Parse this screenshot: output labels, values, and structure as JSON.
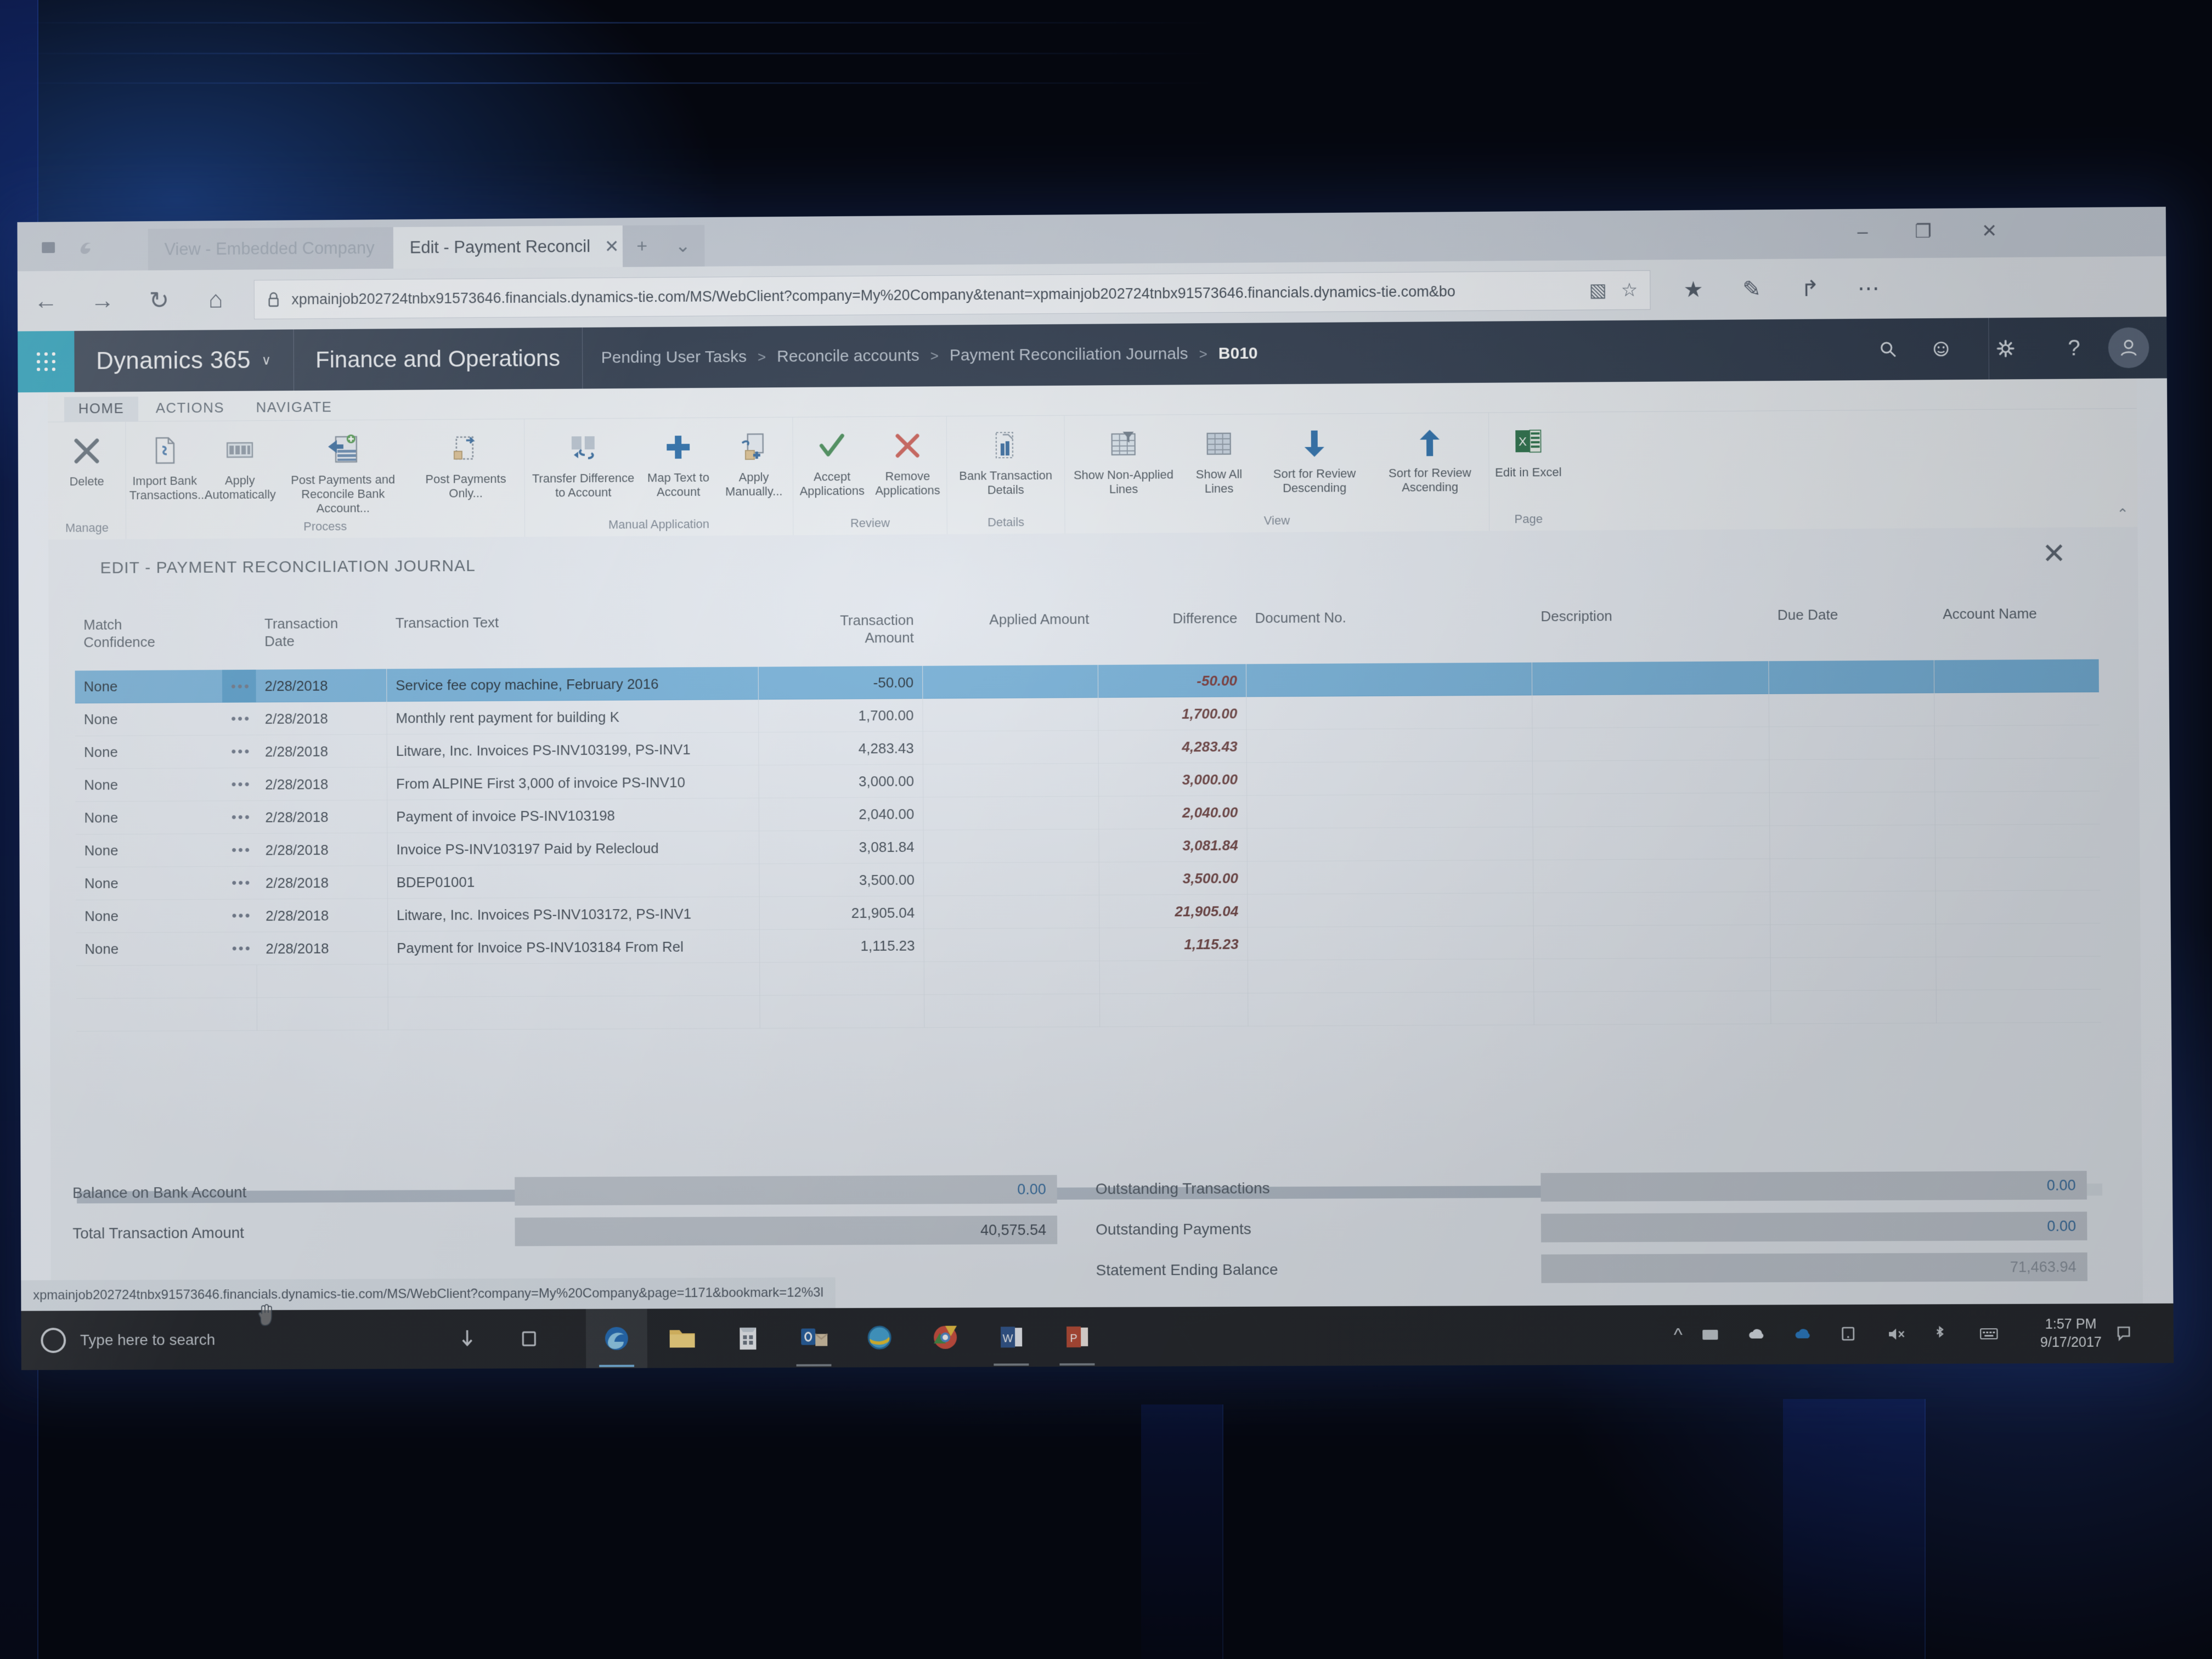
{
  "browser": {
    "tabs": [
      {
        "title": "View - Embedded Company",
        "active": false
      },
      {
        "title": "Edit - Payment Reconcil",
        "active": true
      }
    ],
    "new_tab_label": "+",
    "tab_menu_caret": "⌄",
    "tab_close": "✕",
    "window_controls": {
      "minimize": "–",
      "maximize": "❐",
      "close": "✕"
    },
    "nav": {
      "back": "←",
      "forward": "→",
      "refresh": "↻",
      "home": "⌂"
    },
    "url": "xpmainjob202724tnbx91573646.financials.dynamics-tie.com/MS/WebClient?company=My%20Company&tenant=xpmainjob202724tnbx91573646.financials.dynamics-tie.com&bo",
    "url_lock_icon": "🔒",
    "reading_view_icon": "▧",
    "favorite_icon": "☆",
    "hub_icon": "★",
    "webnote_icon": "✎",
    "share_icon": "↱",
    "more_icon": "⋯",
    "status_url": "xpmainjob202724tnbx91573646.financials.dynamics-tie.com/MS/WebClient?company=My%20Company&page=1171&bookmark=12%3l"
  },
  "d365": {
    "brand": "Dynamics 365",
    "brand_caret": "∨",
    "module": "Finance and Operations",
    "breadcrumb": [
      "Pending User Tasks",
      "Reconcile accounts",
      "Payment Reconciliation Journals",
      "B010"
    ],
    "breadcrumb_separator": ">",
    "icons": {
      "search": "⌕",
      "feedback": "☺",
      "settings": "⚙",
      "help": "?",
      "account": "ᵒ"
    }
  },
  "ribbon": {
    "tabs": [
      {
        "label": "HOME",
        "active": true
      },
      {
        "label": "ACTIONS",
        "active": false
      },
      {
        "label": "NAVIGATE",
        "active": false
      }
    ],
    "collapse_icon": "⌃",
    "groups": [
      {
        "label": "Manage",
        "buttons": [
          {
            "label": "Delete",
            "icon": "delete-x-icon",
            "width": "rbtn"
          }
        ]
      },
      {
        "label": "Process",
        "buttons": [
          {
            "label": "Import Bank Transactions...",
            "icon": "import-bank-transactions-icon",
            "width": "rbtn"
          },
          {
            "label": "Apply Automatically",
            "icon": "apply-automatically-icon",
            "width": "rbtn"
          },
          {
            "label": "Post Payments and Reconcile Bank Account...",
            "icon": "post-payments-reconcile-icon",
            "width": "xwide"
          },
          {
            "label": "Post Payments Only...",
            "icon": "post-payments-only-icon",
            "width": "wide"
          }
        ]
      },
      {
        "label": "Manual Application",
        "buttons": [
          {
            "label": "Transfer Difference to Account",
            "icon": "transfer-difference-icon",
            "width": "wide"
          },
          {
            "label": "Map Text to Account",
            "icon": "map-text-to-account-icon",
            "width": "rbtn"
          },
          {
            "label": "Apply Manually...",
            "icon": "apply-manually-icon",
            "width": "rbtn"
          }
        ]
      },
      {
        "label": "Review",
        "buttons": [
          {
            "label": "Accept Applications",
            "icon": "accept-applications-check-icon",
            "width": "rbtn"
          },
          {
            "label": "Remove Applications",
            "icon": "remove-applications-x-icon",
            "width": "rbtn"
          }
        ]
      },
      {
        "label": "Details",
        "buttons": [
          {
            "label": "Bank Transaction Details",
            "icon": "bank-transaction-details-icon",
            "width": "wide"
          }
        ]
      },
      {
        "label": "View",
        "buttons": [
          {
            "label": "Show Non-Applied Lines",
            "icon": "show-non-applied-lines-icon",
            "width": "wide"
          },
          {
            "label": "Show All Lines",
            "icon": "show-all-lines-icon",
            "width": "rbtn"
          },
          {
            "label": "Sort for Review Descending",
            "icon": "sort-descending-arrow-icon",
            "width": "wide"
          },
          {
            "label": "Sort for Review Ascending",
            "icon": "sort-ascending-arrow-icon",
            "width": "wide"
          }
        ]
      },
      {
        "label": "Page",
        "buttons": [
          {
            "label": "Edit in Excel",
            "icon": "edit-in-excel-icon",
            "width": "rbtn"
          }
        ]
      }
    ]
  },
  "form": {
    "title": "EDIT - PAYMENT RECONCILIATION JOURNAL",
    "close_icon": "✕"
  },
  "grid": {
    "columns": [
      {
        "key": "match",
        "label": "Match Confidence",
        "align": "left"
      },
      {
        "key": "dots",
        "label": "",
        "align": "center"
      },
      {
        "key": "date",
        "label": "Transaction Date",
        "align": "left"
      },
      {
        "key": "text",
        "label": "Transaction Text",
        "align": "left"
      },
      {
        "key": "amount",
        "label": "Transaction Amount",
        "align": "right"
      },
      {
        "key": "applied",
        "label": "Applied Amount",
        "align": "right"
      },
      {
        "key": "difference",
        "label": "Difference",
        "align": "right"
      },
      {
        "key": "docno",
        "label": "Document No.",
        "align": "left"
      },
      {
        "key": "description",
        "label": "Description",
        "align": "left"
      },
      {
        "key": "duedate",
        "label": "Due Date",
        "align": "left"
      },
      {
        "key": "accountname",
        "label": "Account Name",
        "align": "left"
      }
    ],
    "row_menu_glyph": "•••",
    "rows": [
      {
        "match": "None",
        "date": "2/28/2018",
        "text": "Service fee copy machine, February 2016",
        "amount": "-50.00",
        "applied": "",
        "difference": "-50.00",
        "docno": "",
        "description": "",
        "duedate": "",
        "accountname": "",
        "selected": true
      },
      {
        "match": "None",
        "date": "2/28/2018",
        "text": "Monthly rent payment for building K",
        "amount": "1,700.00",
        "applied": "",
        "difference": "1,700.00",
        "docno": "",
        "description": "",
        "duedate": "",
        "accountname": "",
        "selected": false
      },
      {
        "match": "None",
        "date": "2/28/2018",
        "text": "Litware, Inc. Invoices PS-INV103199, PS-INV1",
        "amount": "4,283.43",
        "applied": "",
        "difference": "4,283.43",
        "docno": "",
        "description": "",
        "duedate": "",
        "accountname": "",
        "selected": false
      },
      {
        "match": "None",
        "date": "2/28/2018",
        "text": "From ALPINE First 3,000 of invoice PS-INV10",
        "amount": "3,000.00",
        "applied": "",
        "difference": "3,000.00",
        "docno": "",
        "description": "",
        "duedate": "",
        "accountname": "",
        "selected": false
      },
      {
        "match": "None",
        "date": "2/28/2018",
        "text": "Payment of invoice PS-INV103198",
        "amount": "2,040.00",
        "applied": "",
        "difference": "2,040.00",
        "docno": "",
        "description": "",
        "duedate": "",
        "accountname": "",
        "selected": false
      },
      {
        "match": "None",
        "date": "2/28/2018",
        "text": "Invoice PS-INV103197 Paid by Relecloud",
        "amount": "3,081.84",
        "applied": "",
        "difference": "3,081.84",
        "docno": "",
        "description": "",
        "duedate": "",
        "accountname": "",
        "selected": false
      },
      {
        "match": "None",
        "date": "2/28/2018",
        "text": "BDEP01001",
        "amount": "3,500.00",
        "applied": "",
        "difference": "3,500.00",
        "docno": "",
        "description": "",
        "duedate": "",
        "accountname": "",
        "selected": false
      },
      {
        "match": "None",
        "date": "2/28/2018",
        "text": "Litware, Inc. Invoices PS-INV103172, PS-INV1",
        "amount": "21,905.04",
        "applied": "",
        "difference": "21,905.04",
        "docno": "",
        "description": "",
        "duedate": "",
        "accountname": "",
        "selected": false
      },
      {
        "match": "None",
        "date": "2/28/2018",
        "text": "Payment for Invoice PS-INV103184 From Rel",
        "amount": "1,115.23",
        "applied": "",
        "difference": "1,115.23",
        "docno": "",
        "description": "",
        "duedate": "",
        "accountname": "",
        "selected": false
      }
    ]
  },
  "totals": {
    "left": [
      {
        "label": "Balance on Bank Account",
        "value": "0.00",
        "style": "blue"
      },
      {
        "label": "Total Transaction Amount",
        "value": "40,575.54",
        "style": "normal"
      }
    ],
    "right": [
      {
        "label": "Outstanding Transactions",
        "value": "0.00",
        "style": "blue"
      },
      {
        "label": "Outstanding Payments",
        "value": "0.00",
        "style": "blue"
      },
      {
        "label": "Statement Ending Balance",
        "value": "71,463.94",
        "style": "muted"
      }
    ]
  },
  "taskbar": {
    "search_placeholder": "Type here to search",
    "cortana_icon": "cortana-ring-icon",
    "system_icons": [
      "task-view-down-icon",
      "task-view-icon"
    ],
    "apps": [
      {
        "name": "edge-blue-icon",
        "state": "active"
      },
      {
        "name": "file-explorer-icon",
        "state": "idle"
      },
      {
        "name": "store-icon",
        "state": "idle"
      },
      {
        "name": "outlook-icon",
        "state": "open"
      },
      {
        "name": "internet-explorer-icon",
        "state": "idle"
      },
      {
        "name": "chrome-icon",
        "state": "idle"
      },
      {
        "name": "word-icon",
        "state": "open"
      },
      {
        "name": "powerpoint-icon",
        "state": "open"
      }
    ],
    "tray": [
      "show-hidden-icons-chevron",
      "keyboard-tray-icon",
      "onedrive-white-icon",
      "onedrive-blue-icon",
      "display-icon",
      "volume-muted-icon",
      "bluetooth-icon",
      "keyboard-layout-icon"
    ],
    "time": "1:57 PM",
    "date": "9/17/2017",
    "action_center_icon": "action-center-icon"
  },
  "colors": {
    "d365_bar": "#2b3a4f",
    "waffle_accent": "#13a5c6",
    "row_selected": "#6db4e4",
    "difference_text": "#6d3b3b",
    "taskbar": "#22262c"
  }
}
